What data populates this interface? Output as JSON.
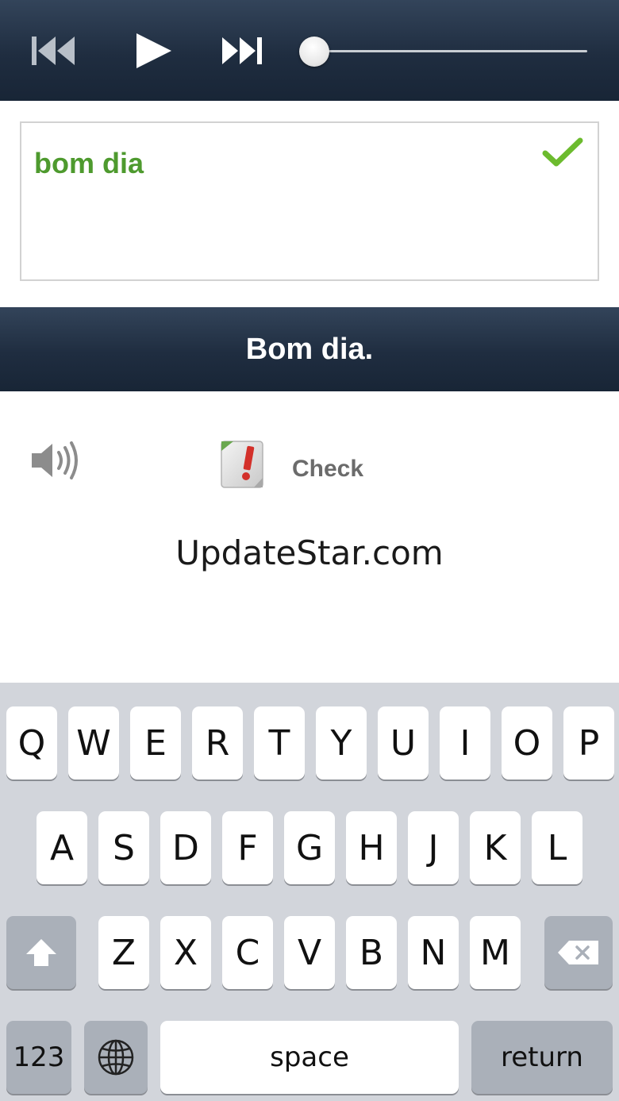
{
  "player": {
    "icons": [
      "skip-back-icon",
      "play-icon",
      "skip-forward-icon"
    ],
    "progress": 0.05
  },
  "answer": {
    "text": "bom dia",
    "status": "correct",
    "text_color": "#4e9a2e"
  },
  "solution": {
    "text": "Bom dia."
  },
  "controls": {
    "speaker_icon": "speaker-icon",
    "check_icon": "check-notepad-icon",
    "check_label": "Check"
  },
  "watermark": "UpdateStar.com",
  "keyboard": {
    "row1": [
      "Q",
      "W",
      "E",
      "R",
      "T",
      "Y",
      "U",
      "I",
      "O",
      "P"
    ],
    "row2": [
      "A",
      "S",
      "D",
      "F",
      "G",
      "H",
      "J",
      "K",
      "L"
    ],
    "row3": [
      "Z",
      "X",
      "C",
      "V",
      "B",
      "N",
      "M"
    ],
    "numbers_label": "123",
    "space_label": "space",
    "return_label": "return"
  },
  "colors": {
    "bar_dark": "#1f2d40",
    "accent_green": "#6cbb2e",
    "keyboard_bg": "#d2d5db"
  }
}
